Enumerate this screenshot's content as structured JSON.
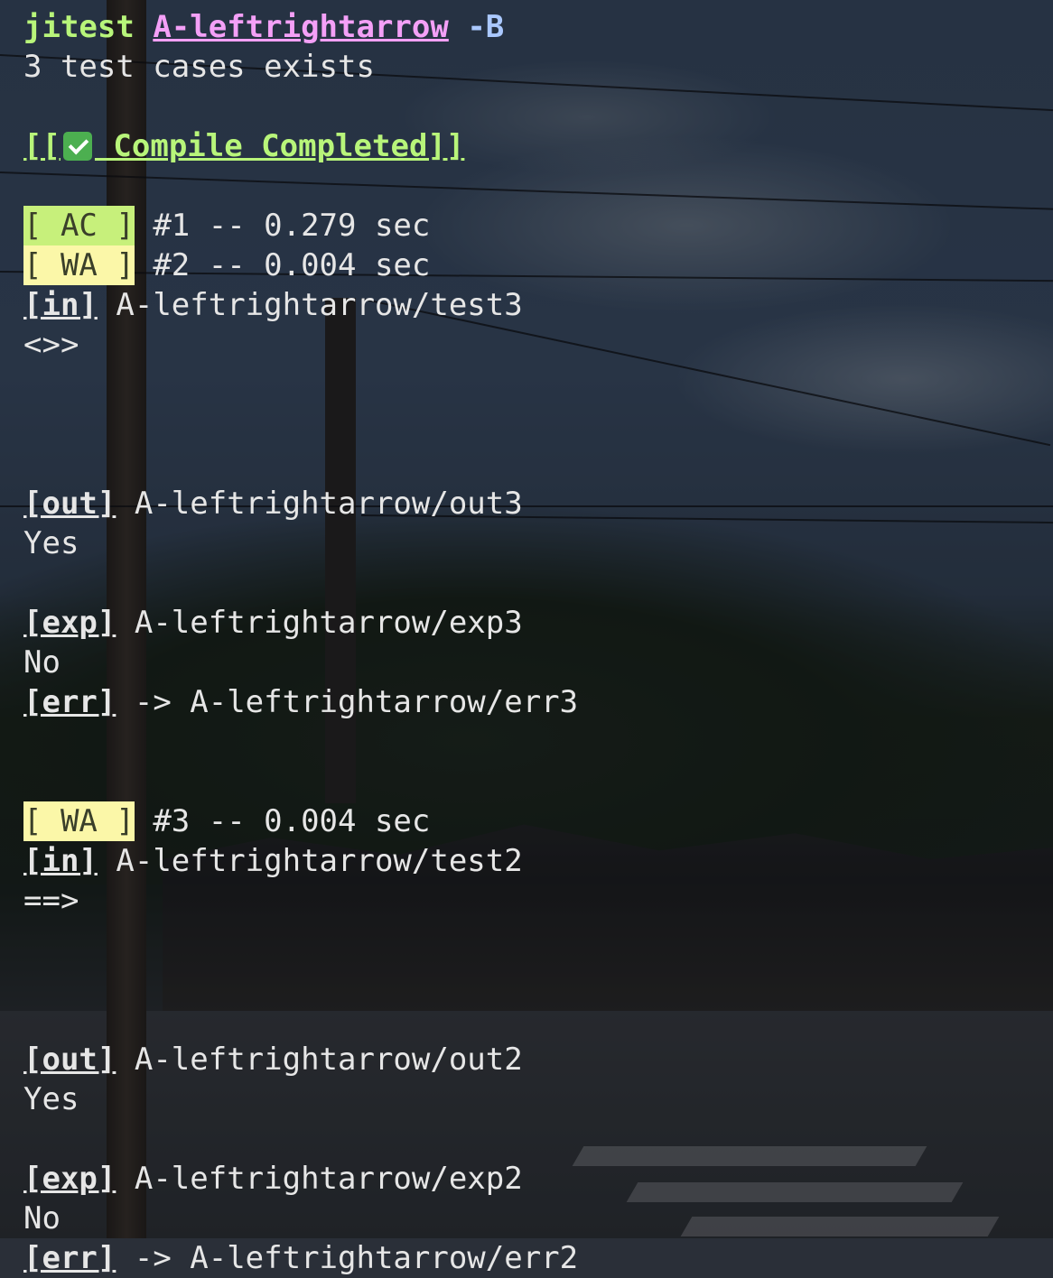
{
  "terminal": {
    "command": {
      "program": "jitest",
      "argument": "A-leftrightarrow",
      "flag": "-B"
    },
    "summary": "3 test cases exists",
    "compile": {
      "prefix": "[[",
      "icon": "check-mark-button-icon",
      "label": " Compile Completed]]"
    },
    "results": [
      {
        "status": "[ AC ]",
        "status_color": "#c7f07b",
        "detail": "#1 -- 0.279 sec"
      },
      {
        "status": "[ WA ]",
        "status_color": "#fbf7a8",
        "detail": "#2 -- 0.004 sec",
        "in_tag": "[in]",
        "in_path": "A-leftrightarrow/test3",
        "in_content": "<>>",
        "out_tag": "[out]",
        "out_path": "A-leftrightarrow/out3",
        "out_content": "Yes",
        "exp_tag": "[exp]",
        "exp_path": "A-leftrightarrow/exp3",
        "exp_content": "No",
        "err_tag": "[err]",
        "err_path": "-> A-leftrightarrow/err3"
      },
      {
        "status": "[ WA ]",
        "status_color": "#fbf7a8",
        "detail": "#3 -- 0.004 sec",
        "in_tag": "[in]",
        "in_path": "A-leftrightarrow/test2",
        "in_content": "==>",
        "out_tag": "[out]",
        "out_path": "A-leftrightarrow/out2",
        "out_content": "Yes",
        "exp_tag": "[exp]",
        "exp_path": "A-leftrightarrow/exp2",
        "exp_content": "No",
        "err_tag": "[err]",
        "err_path": "-> A-leftrightarrow/err2"
      }
    ]
  },
  "colors": {
    "command": "#b8f57a",
    "argument": "#f4a0f7",
    "flag": "#aac8ff",
    "compile": "#b8f57a",
    "ac_badge": "#c7f07b",
    "wa_badge": "#fbf7a8",
    "text": "#e6e6e6"
  }
}
